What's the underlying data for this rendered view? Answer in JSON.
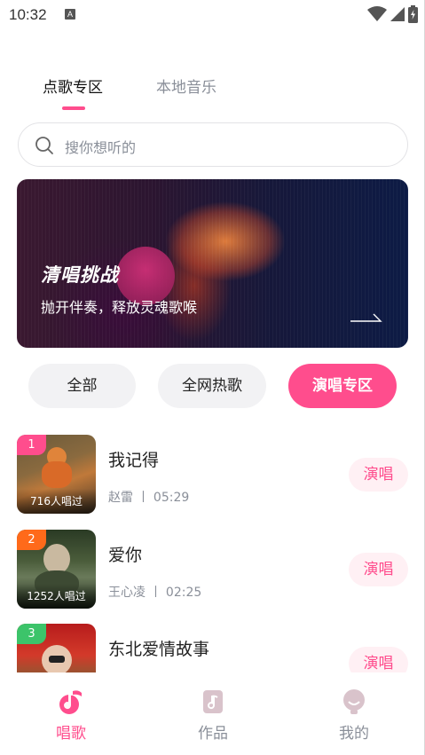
{
  "status_bar": {
    "time": "10:32",
    "notification_letter": "A"
  },
  "tabs": [
    {
      "label": "点歌专区",
      "active": true
    },
    {
      "label": "本地音乐",
      "active": false
    }
  ],
  "search": {
    "placeholder": "搜你想听的"
  },
  "banner": {
    "title": "清唱挑战",
    "subtitle": "抛开伴奏，释放灵魂歌喉"
  },
  "filters": [
    {
      "label": "全部",
      "selected": false
    },
    {
      "label": "全网热歌",
      "selected": false
    },
    {
      "label": "演唱专区",
      "selected": true
    }
  ],
  "songs": [
    {
      "rank": "1",
      "rank_color": "#ff4d8d",
      "title": "我记得",
      "artist": "赵雷",
      "duration": "05:29",
      "sung_count": "716人唱过",
      "action": "演唱"
    },
    {
      "rank": "2",
      "rank_color": "#ff6a1a",
      "title": "爱你",
      "artist": "王心凌",
      "duration": "02:25",
      "sung_count": "1252人唱过",
      "action": "演唱"
    },
    {
      "rank": "3",
      "rank_color": "#3cc46a",
      "title": "东北爱情故事",
      "artist": "",
      "duration": "",
      "sung_count": "",
      "action": "演唱"
    }
  ],
  "separator": "丨",
  "bottom_nav": [
    {
      "label": "唱歌",
      "icon": "music-note-icon",
      "active": true
    },
    {
      "label": "作品",
      "icon": "document-music-icon",
      "active": false
    },
    {
      "label": "我的",
      "icon": "smiley-face-icon",
      "active": false
    }
  ],
  "colors": {
    "accent": "#ff4d8d",
    "accent_light": "#fff0f4",
    "muted_text": "#8a8f99"
  }
}
